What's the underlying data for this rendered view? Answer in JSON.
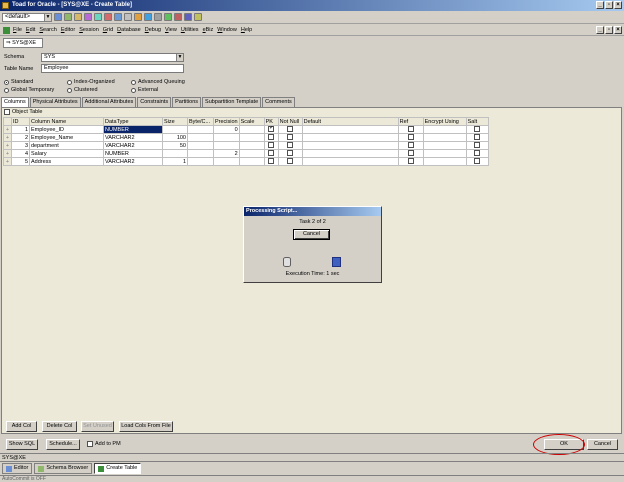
{
  "window": {
    "title": "Toad for Oracle - [SYS@XE - Create Table]"
  },
  "toolbar": {
    "profile_combo": "<default>"
  },
  "menu": [
    "File",
    "Edit",
    "Search",
    "Editor",
    "Session",
    "Grid",
    "Database",
    "Debug",
    "View",
    "Utilities",
    "eBiz",
    "Window",
    "Help"
  ],
  "connection": "SYS@XE",
  "schema": {
    "label": "Schema",
    "value": "SYS"
  },
  "table_name": {
    "label": "Table Name",
    "value": "Employee"
  },
  "table_types": {
    "standard": "Standard",
    "index_organized": "Index-Organized",
    "advanced_queuing": "Advanced Queuing",
    "global_temporary": "Global Temporary",
    "clustered": "Clustered",
    "external": "External"
  },
  "tabs": [
    "Columns",
    "Physical Attributes",
    "Additional Attributes",
    "Constraints",
    "Partitions",
    "Subpartition Template",
    "Comments"
  ],
  "object_table_label": "Object Table",
  "grid": {
    "headers": [
      "ID",
      "Column Name",
      "DataType",
      "Size",
      "Byte/C...",
      "Precision",
      "Scale",
      "PK",
      "Not Null",
      "Default",
      "Ref",
      "Encrypt Using",
      "Salt"
    ],
    "rows": [
      {
        "id": "1",
        "name": "Employee_ID",
        "type": "NUMBER",
        "size": "",
        "precision": "0",
        "pk": true
      },
      {
        "id": "2",
        "name": "Employee_Name",
        "type": "VARCHAR2",
        "size": "100",
        "precision": "",
        "pk": false
      },
      {
        "id": "3",
        "name": "department",
        "type": "VARCHAR2",
        "size": "50",
        "precision": "",
        "pk": false
      },
      {
        "id": "4",
        "name": "Salary",
        "type": "NUMBER",
        "size": "",
        "precision": "2",
        "pk": false
      },
      {
        "id": "5",
        "name": "Address",
        "type": "VARCHAR2",
        "size": "1",
        "precision": "",
        "pk": false
      }
    ]
  },
  "grid_buttons": {
    "add_col": "Add Col",
    "delete_col": "Delete Col",
    "set_unused": "Set Unused",
    "load_cols": "Load Cols From File"
  },
  "bottom_buttons": {
    "show_sql": "Show SQL",
    "schedule": "Schedule...",
    "add_to_pm": "Add to PM",
    "ok": "OK",
    "cancel": "Cancel"
  },
  "dialog": {
    "title": "Processing Script...",
    "task": "Task 2 of 2",
    "cancel": "Cancel",
    "exec_time": "Execution Time: 1 sec"
  },
  "status": {
    "connection": "SYS@XE",
    "bottom": "AutoCommit is OFF"
  },
  "taskbar": [
    "Editor",
    "Schema Browser",
    "Create Table"
  ],
  "colors": {
    "title_start": "#0a246a",
    "title_end": "#a6caf0",
    "highlight_ring": "#cc0000",
    "selection": "#0a246a"
  }
}
